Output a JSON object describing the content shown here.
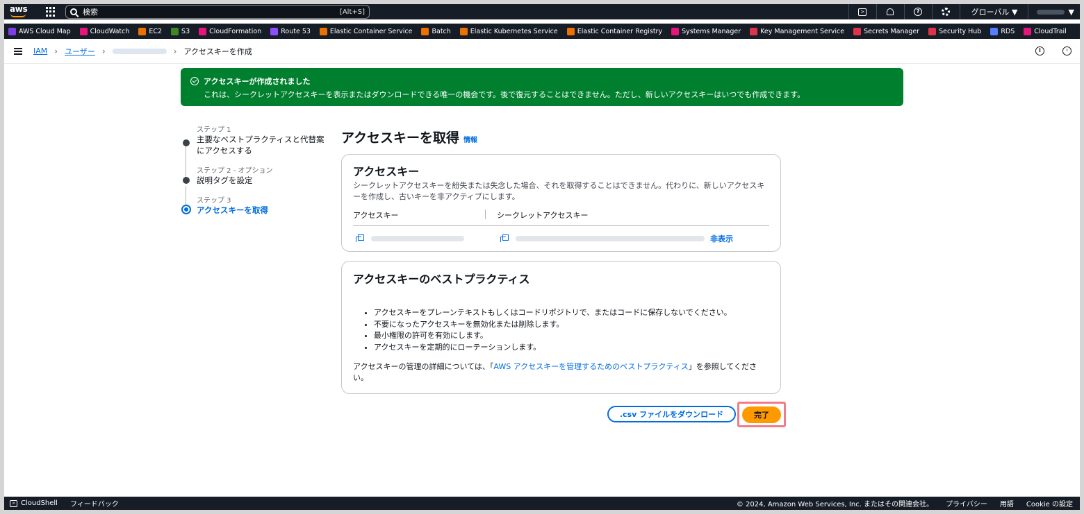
{
  "topnav": {
    "logo_text": "aws",
    "search_placeholder": "検索",
    "search_shortcut": "[Alt+S]",
    "cloudshell_icon": "terminal-icon",
    "region": "グローバル ▼",
    "account_caret": "▼"
  },
  "favorites": [
    {
      "label": "AWS Cloud Map",
      "color": "#7b3fe4"
    },
    {
      "label": "CloudWatch",
      "color": "#e7157b"
    },
    {
      "label": "EC2",
      "color": "#ed7100"
    },
    {
      "label": "S3",
      "color": "#3f8624"
    },
    {
      "label": "CloudFormation",
      "color": "#e7157b"
    },
    {
      "label": "Route 53",
      "color": "#8c4fff"
    },
    {
      "label": "Elastic Container Service",
      "color": "#ed7100"
    },
    {
      "label": "Batch",
      "color": "#ed7100"
    },
    {
      "label": "Elastic Kubernetes Service",
      "color": "#ed7100"
    },
    {
      "label": "Elastic Container Registry",
      "color": "#ed7100"
    },
    {
      "label": "Systems Manager",
      "color": "#e7157b"
    },
    {
      "label": "Key Management Service",
      "color": "#dd344c"
    },
    {
      "label": "Secrets Manager",
      "color": "#dd344c"
    },
    {
      "label": "Security Hub",
      "color": "#dd344c"
    },
    {
      "label": "RDS",
      "color": "#527fff"
    },
    {
      "label": "CloudTrail",
      "color": "#e7157b"
    }
  ],
  "breadcrumb": {
    "iam": "IAM",
    "users": "ユーザー",
    "current": "アクセスキーを作成"
  },
  "flash": {
    "title": "アクセスキーが作成されました",
    "message": "これは、シークレットアクセスキーを表示またはダウンロードできる唯一の機会です。後で復元することはできません。ただし、新しいアクセスキーはいつでも作成できます。"
  },
  "steps": [
    {
      "label": "ステップ 1",
      "title_line1": "主要なベストプラクティスと代替案",
      "title_line2": "にアクセスする"
    },
    {
      "label": "ステップ 2 - オプション",
      "title_line1": "説明タグを設定",
      "title_line2": ""
    },
    {
      "label": "ステップ 3",
      "title_line1": "アクセスキーを取得",
      "title_line2": ""
    }
  ],
  "main": {
    "title": "アクセスキーを取得",
    "info_link": "情報"
  },
  "access_key_card": {
    "title": "アクセスキー",
    "description": "シークレットアクセスキーを紛失または失念した場合、それを取得することはできません。代わりに、新しいアクセスキーを作成し、古いキーを非アクティブにします。",
    "col_access_key": "アクセスキー",
    "col_secret_key": "シークレットアクセスキー",
    "hide_label": "非表示"
  },
  "best_practices_card": {
    "title": "アクセスキーのベストプラクティス",
    "items": [
      "アクセスキーをプレーンテキストもしくはコードリポジトリで、またはコードに保存しないでください。",
      "不要になったアクセスキーを無効化または削除します。",
      "最小権限の許可を有効にします。",
      "アクセスキーを定期的にローテーションします。"
    ],
    "more_prefix": "アクセスキーの管理の詳細については、「",
    "more_link": "AWS アクセスキーを管理するためのベストプラクティス",
    "more_suffix": "」を参照してください。"
  },
  "buttons": {
    "download_csv": ".csv ファイルをダウンロード",
    "done": "完了"
  },
  "footer": {
    "cloudshell": "CloudShell",
    "feedback": "フィードバック",
    "copyright": "© 2024, Amazon Web Services, Inc. またはその関連会社。",
    "privacy": "プライバシー",
    "terms": "用語",
    "cookie": "Cookie の設定"
  }
}
